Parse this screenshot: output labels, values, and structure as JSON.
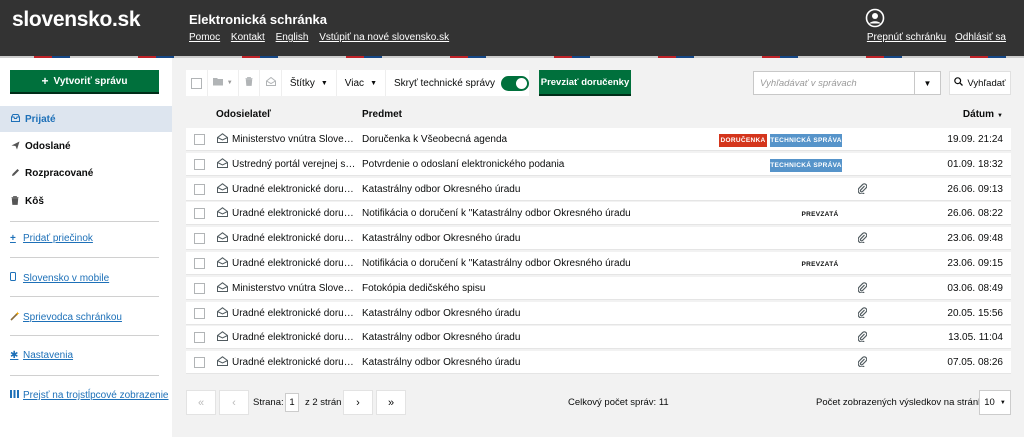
{
  "header": {
    "logo": "slovensko.sk",
    "app_title": "Elektronická schránka",
    "nav": [
      "Pomoc",
      "Kontakt",
      "English",
      "Vstúpiť na nové slovensko.sk"
    ],
    "switch_box": "Prepnúť schránku",
    "logout": "Odhlásiť sa"
  },
  "sidebar": {
    "create_label": "Vytvoriť správu",
    "folders": [
      {
        "label": "Prijaté",
        "icon": "inbox-icon"
      },
      {
        "label": "Odoslané",
        "icon": "send-icon"
      },
      {
        "label": "Rozpracované",
        "icon": "pencil-icon"
      },
      {
        "label": "Kôš",
        "icon": "trash-icon"
      }
    ],
    "add_folder": "Pridať priečinok",
    "mobile": "Slovensko v mobile",
    "guide": "Sprievodca schránkou",
    "settings": "Nastavenia",
    "three_column": "Prejsť na trojstĺpcové zobrazenie"
  },
  "toolbar": {
    "labels_dd": "Štítky",
    "more_dd": "Viac",
    "hide_tech": "Skryť technické správy",
    "accept_btn": "Prevziať doručenky",
    "search_placeholder": "Vyhľadávať v správach",
    "search_btn": "Vyhľadať"
  },
  "table": {
    "col_sender": "Odosielateľ",
    "col_subject": "Predmet",
    "col_date": "Dátum",
    "rows": [
      {
        "sender": "Ministerstvo vnútra Slovenskej republiky",
        "subject": "Doručenka k Všeobecná agenda",
        "tags": [
          "DORUČENKA",
          "TECHNICKÁ SPRÁVA"
        ],
        "attachment": false,
        "date": "19.09. 21:24"
      },
      {
        "sender": "Ústredný portál verejnej správy",
        "subject": "Potvrdenie o odoslaní elektronického podania",
        "tags": [
          "TECHNICKÁ SPRÁVA"
        ],
        "attachment": false,
        "date": "01.09. 18:32"
      },
      {
        "sender": "Úradné elektronické doručovanie",
        "subject": "Katastrálny odbor Okresného úradu",
        "tags": [],
        "attachment": true,
        "date": "26.06. 09:13"
      },
      {
        "sender": "Úradné elektronické doručovanie",
        "subject": "Notifikácia o doručení k \"Katastrálny odbor Okresného úradu",
        "tags": [
          "PREVZATÁ"
        ],
        "attachment": false,
        "date": "26.06. 08:22"
      },
      {
        "sender": "Úradné elektronické doručovanie",
        "subject": "Katastrálny odbor Okresného úradu",
        "tags": [],
        "attachment": true,
        "date": "23.06. 09:48"
      },
      {
        "sender": "Úradné elektronické doručovanie",
        "subject": "Notifikácia o doručení k \"Katastrálny odbor Okresného úradu",
        "tags": [
          "PREVZATÁ"
        ],
        "attachment": false,
        "date": "23.06. 09:15"
      },
      {
        "sender": "Ministerstvo vnútra Slovenskej republiky",
        "subject": "Fotokópia dedičského spisu",
        "tags": [],
        "attachment": true,
        "date": "03.06. 08:49"
      },
      {
        "sender": "Úradné elektronické doručovanie",
        "subject": "Katastrálny odbor Okresného úradu",
        "tags": [],
        "attachment": true,
        "date": "20.05. 15:56"
      },
      {
        "sender": "Úradné elektronické doručovanie",
        "subject": "Katastrálny odbor Okresného úradu",
        "tags": [],
        "attachment": true,
        "date": "13.05. 11:04"
      },
      {
        "sender": "Úradné elektronické doručovanie",
        "subject": "Katastrálny odbor Okresného úradu",
        "tags": [],
        "attachment": true,
        "date": "07.05. 08:26"
      }
    ]
  },
  "pager": {
    "page_label": "Strana:",
    "page": "1",
    "of_pages": "z 2 strán",
    "total": "Celkový počet správ: 11",
    "per_page_label": "Počet zobrazených výsledkov na stránku:",
    "per_page": "10"
  },
  "colors": {
    "green": "#00703c",
    "red_tag": "#d4351c",
    "blue_tag": "#5694ca",
    "header": "#333333",
    "link": "#1d70b8"
  }
}
